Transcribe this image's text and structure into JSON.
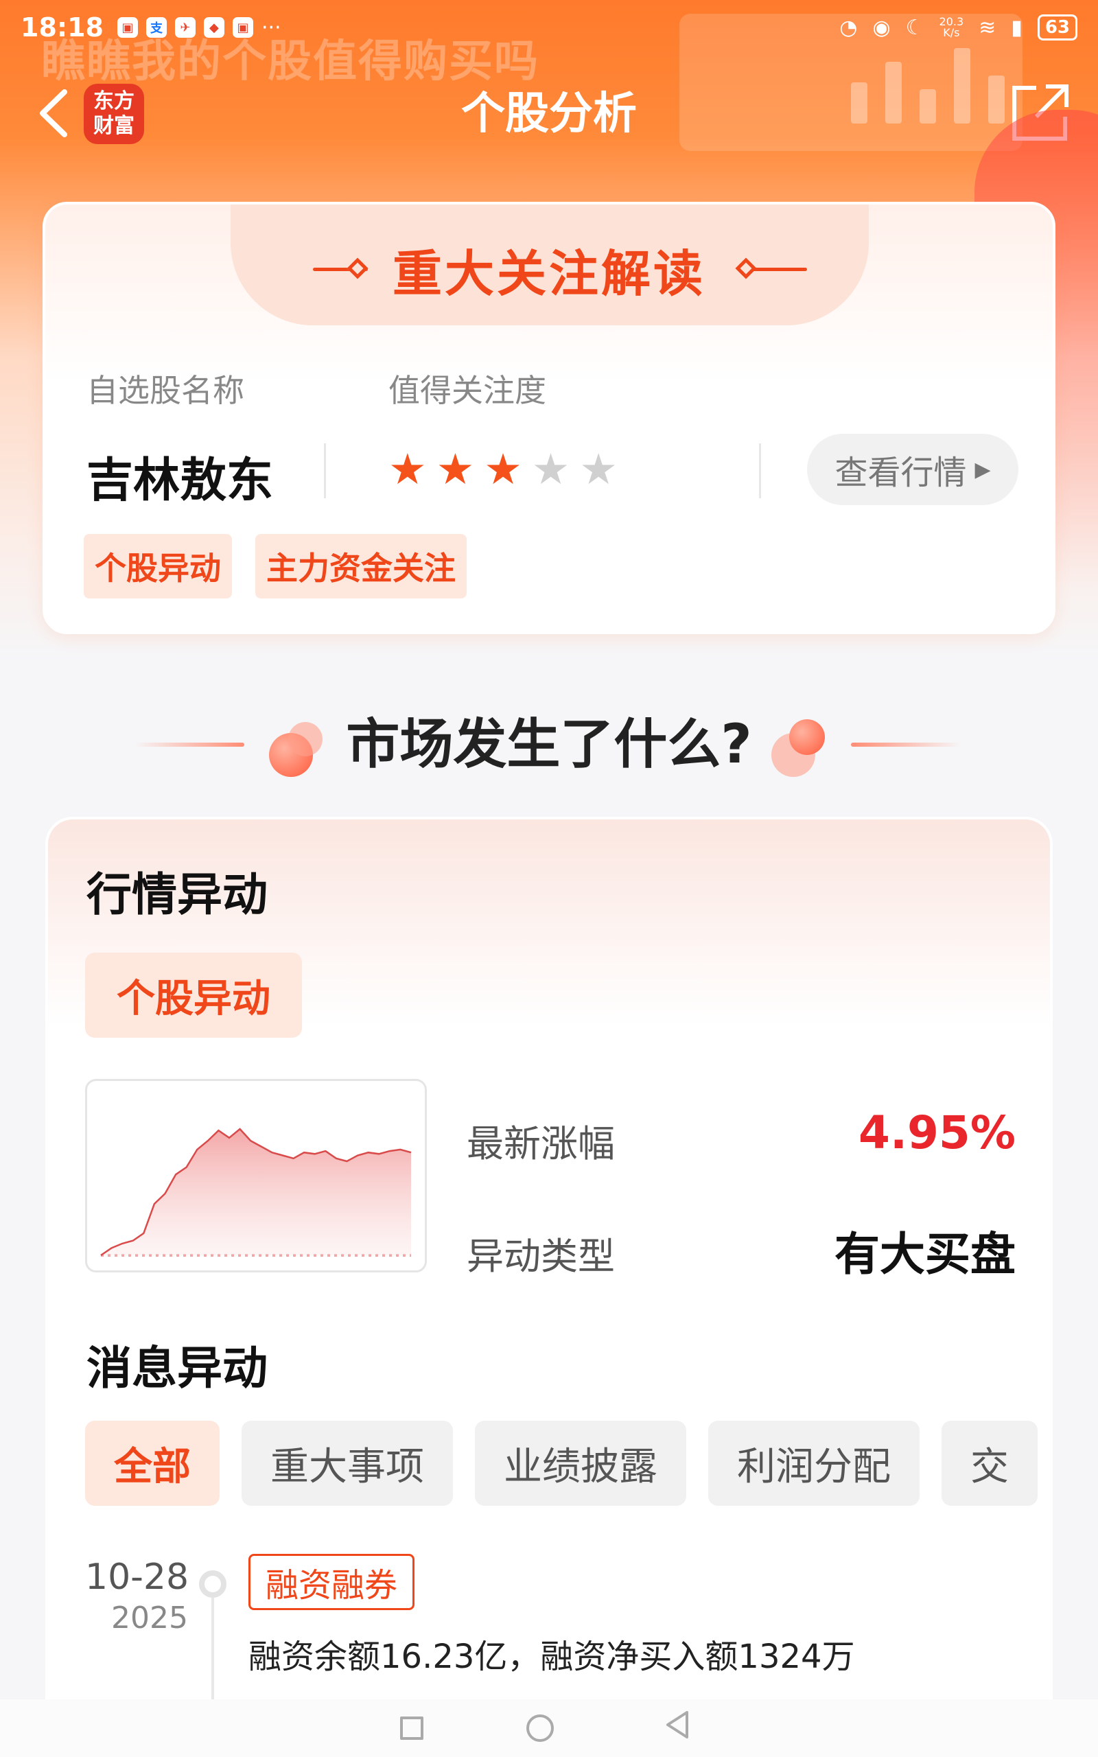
{
  "status_bar": {
    "time": "18:18",
    "net_speed": "20.3",
    "net_unit": "K/s",
    "battery": "63",
    "more": "···"
  },
  "header": {
    "bg_slogan": "瞧瞧我的个股值得购买吗",
    "logo_line1": "东方",
    "logo_line2": "财富",
    "title": "个股分析"
  },
  "attention": {
    "title": "重大关注解读",
    "name_label": "自选股名称",
    "rating_label": "值得关注度",
    "stock_name": "吉林敖东",
    "rating": 3,
    "rating_max": 5,
    "quote_button": "查看行情",
    "tags": [
      "个股异动",
      "主力资金关注"
    ]
  },
  "section": {
    "title": "市场发生了什么?"
  },
  "market": {
    "title": "行情异动",
    "type_button": "个股异动",
    "latest_change_label": "最新涨幅",
    "latest_change_value": "4.95%",
    "anomaly_type_label": "异动类型",
    "anomaly_type_value": "有大买盘",
    "chart_series": [
      0.0,
      0.05,
      0.08,
      0.1,
      0.15,
      0.35,
      0.42,
      0.55,
      0.6,
      0.72,
      0.78,
      0.85,
      0.8,
      0.86,
      0.78,
      0.74,
      0.7,
      0.68,
      0.66,
      0.7,
      0.69,
      0.71,
      0.66,
      0.64,
      0.68,
      0.7,
      0.69,
      0.71,
      0.72,
      0.7
    ]
  },
  "news": {
    "title": "消息异动",
    "filters": [
      "全部",
      "重大事项",
      "业绩披露",
      "利润分配",
      "交"
    ],
    "active_filter": 0,
    "items": [
      {
        "date": "10-28",
        "year": "2025",
        "tag": "融资融券",
        "text": "融资余额16.23亿，融资净买入额1324万"
      }
    ]
  },
  "colors": {
    "accent": "#f0471a",
    "up_red": "#e8262b",
    "header_orange": "#ff7a2c"
  },
  "icons": {
    "back": "chevron-left-icon",
    "share": "external-link-icon",
    "quote_arrow": "caret-right-icon"
  }
}
